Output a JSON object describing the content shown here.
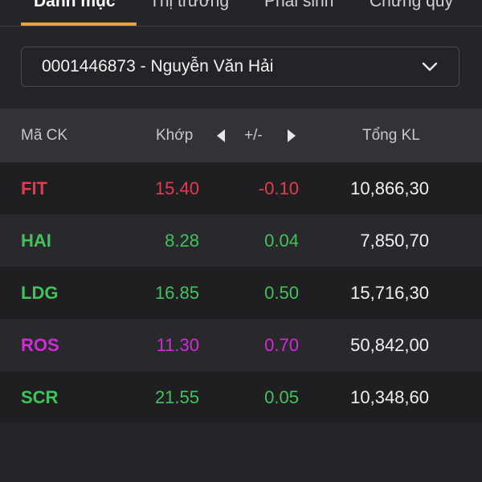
{
  "tabs": [
    {
      "label": "Danh mục",
      "active": true
    },
    {
      "label": "Thị trường",
      "active": false
    },
    {
      "label": "Phái sinh",
      "active": false
    },
    {
      "label": "Chứng quỹ",
      "active": false
    }
  ],
  "account": {
    "selected": "0001446873 - Nguyễn Văn Hải",
    "icon": "chevron-down-icon"
  },
  "table": {
    "headers": {
      "symbol": "Mã CK",
      "match": "Khớp",
      "change": "+/-",
      "volume": "Tổng KL"
    },
    "rows": [
      {
        "symbol": "FIT",
        "price": "15.40",
        "change": "-0.10",
        "volume": "10,866,30",
        "color": "#e8384f"
      },
      {
        "symbol": "HAI",
        "price": "8.28",
        "change": "0.04",
        "volume": "7,850,70",
        "color": "#3fc35a"
      },
      {
        "symbol": "LDG",
        "price": "16.85",
        "change": "0.50",
        "volume": "15,716,30",
        "color": "#3fc35a"
      },
      {
        "symbol": "ROS",
        "price": "11.30",
        "change": "0.70",
        "volume": "50,842,00",
        "color": "#d22ad8"
      },
      {
        "symbol": "SCR",
        "price": "21.55",
        "change": "0.05",
        "volume": "10,348,60",
        "color": "#3fc35a"
      }
    ]
  },
  "colors": {
    "background": "#252529",
    "accent": "#e8a33a",
    "down": "#e8384f",
    "up": "#3fc35a",
    "ceiling": "#d22ad8"
  }
}
